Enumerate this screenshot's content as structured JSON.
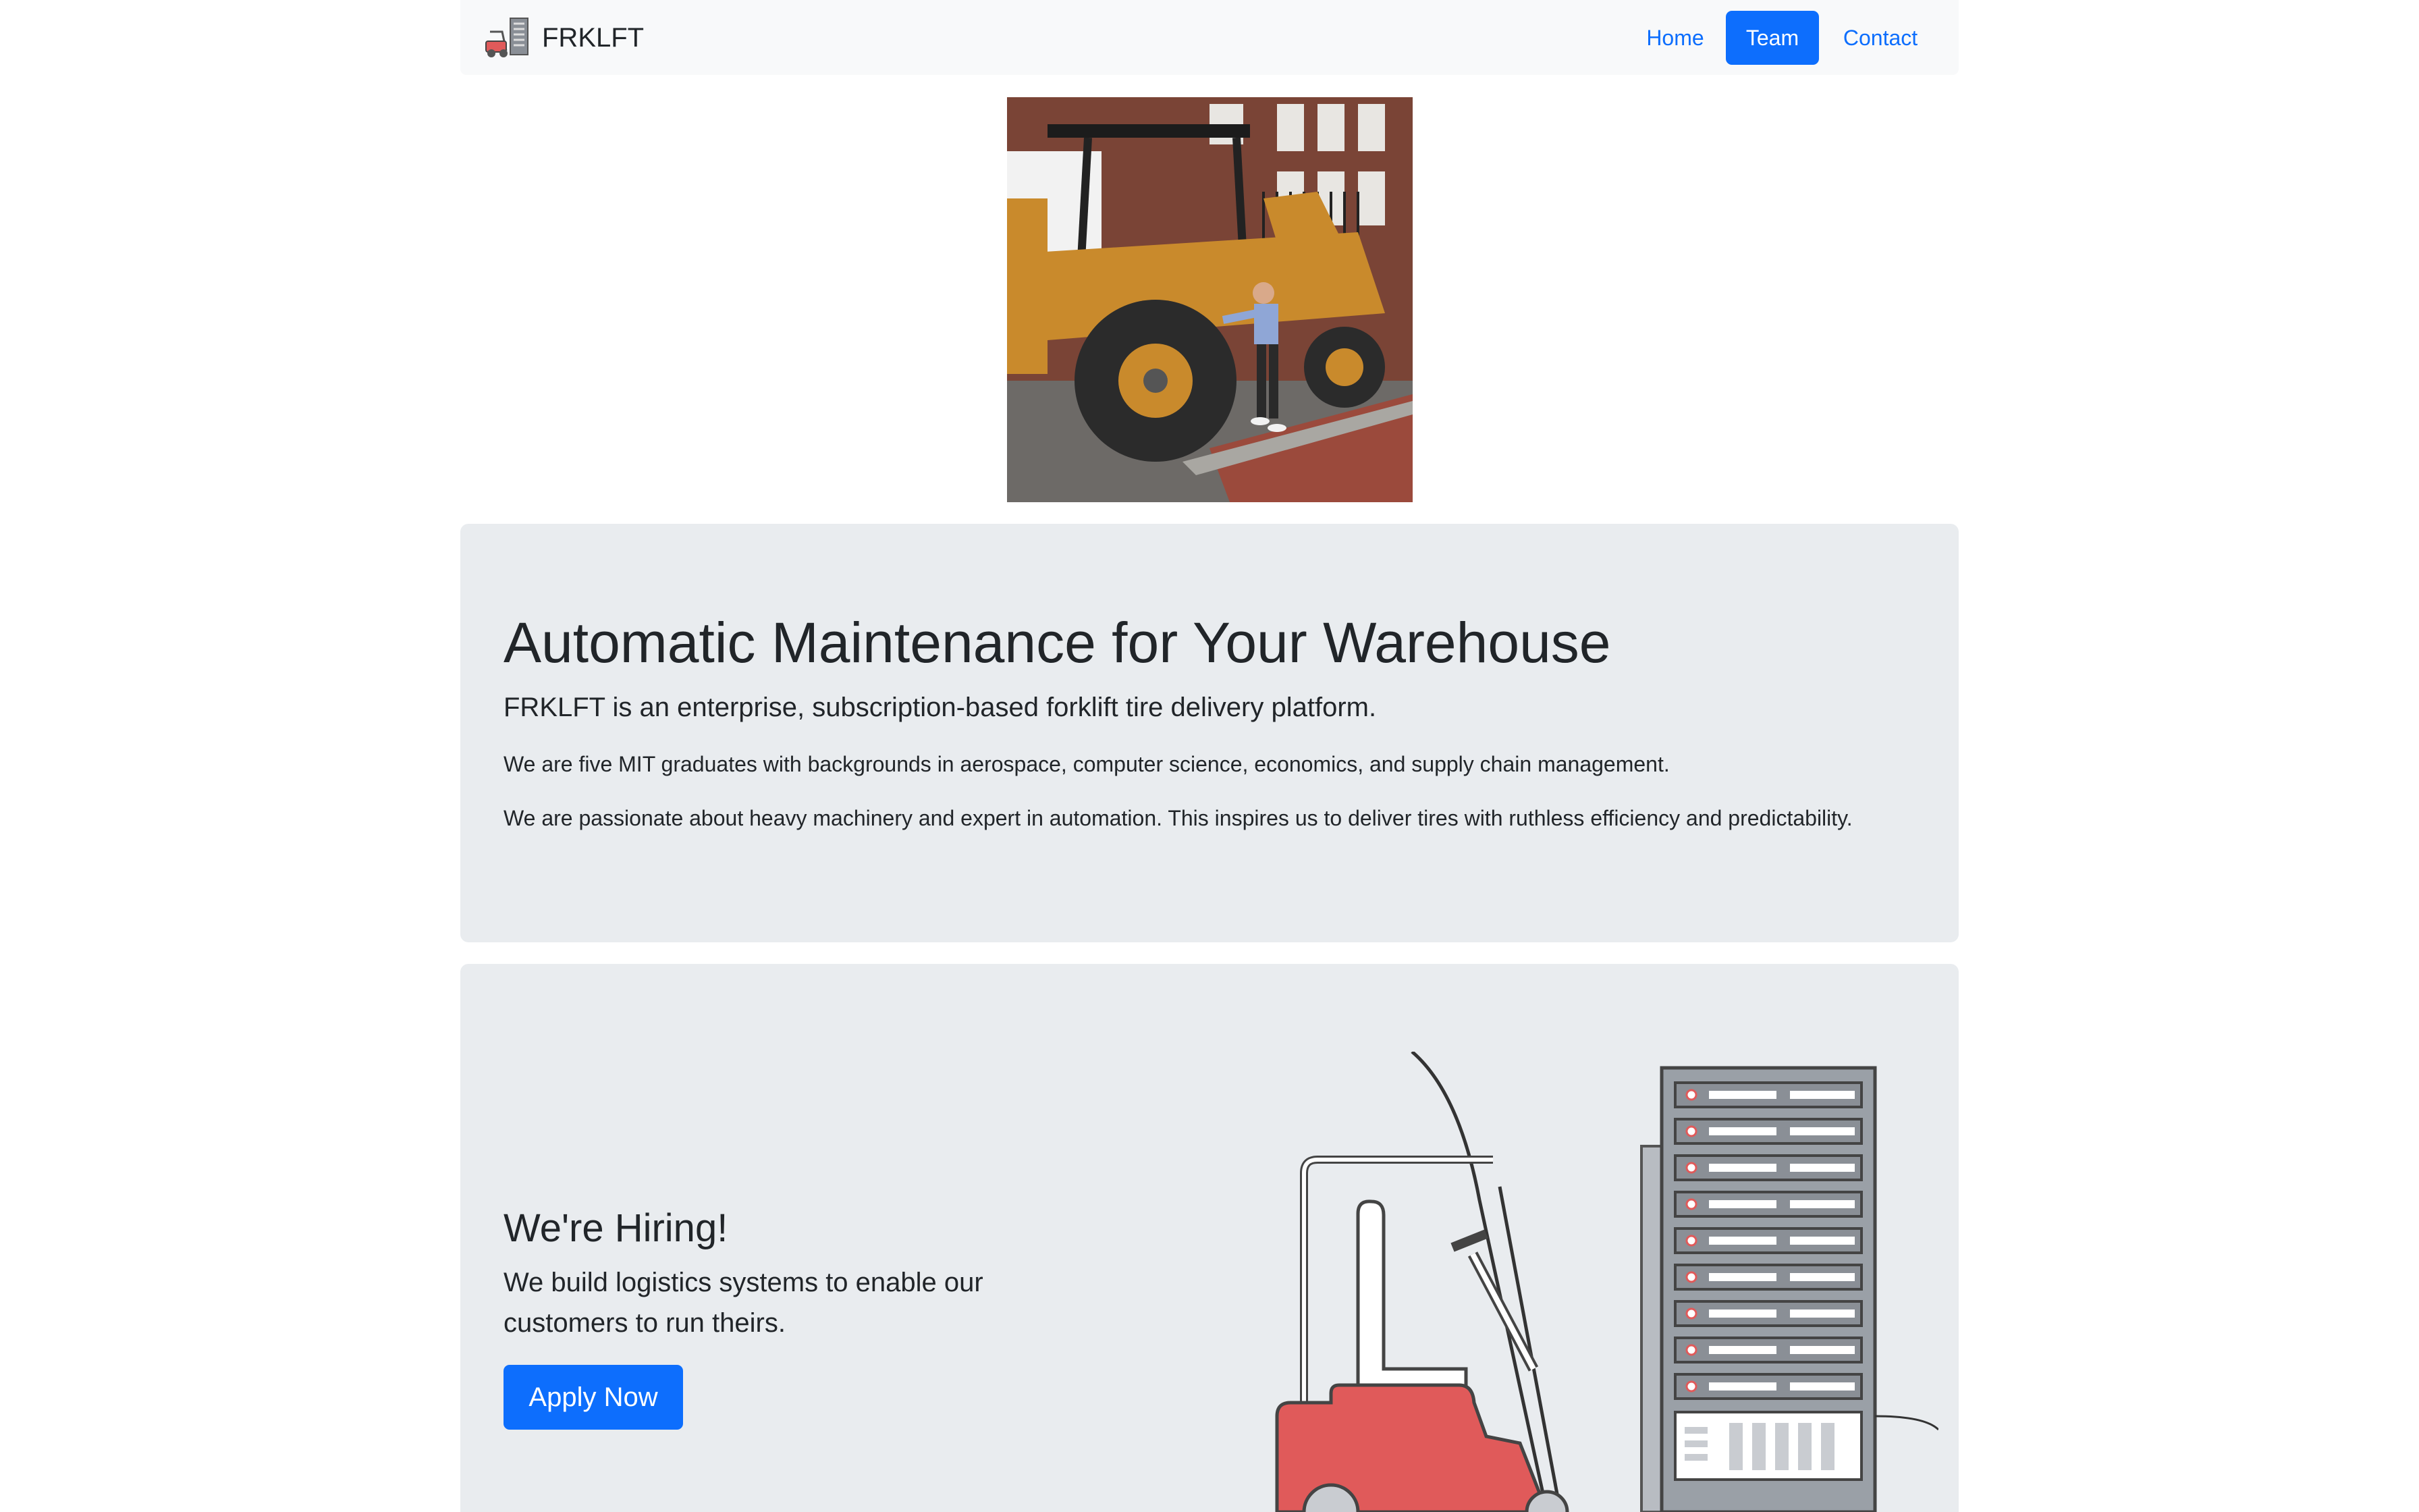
{
  "navbar": {
    "brand": "FRKLFT",
    "links": [
      {
        "label": "Home",
        "active": false
      },
      {
        "label": "Team",
        "active": true
      },
      {
        "label": "Contact",
        "active": false
      }
    ]
  },
  "hero_image": {
    "description_icon": "photo-forklift-person"
  },
  "about": {
    "headline": "Automatic Maintenance for Your Warehouse",
    "lead": "FRKLFT is an enterprise, subscription-based forklift tire delivery platform.",
    "paragraphs": [
      "We are five MIT graduates with backgrounds in aerospace, computer science, economics, and supply chain management.",
      "We are passionate about heavy machinery and expert in automation. This inspires us to deliver tires with ruthless efficiency and predictability."
    ]
  },
  "hiring": {
    "title": "We're Hiring!",
    "text": "We build logistics systems to enable our customers to run theirs.",
    "button": "Apply Now"
  },
  "colors": {
    "accent": "#0d6efd",
    "panel_bg": "#e9ecef",
    "navbar_bg": "#f8f9fa",
    "forklift_red": "#e05a5a"
  }
}
